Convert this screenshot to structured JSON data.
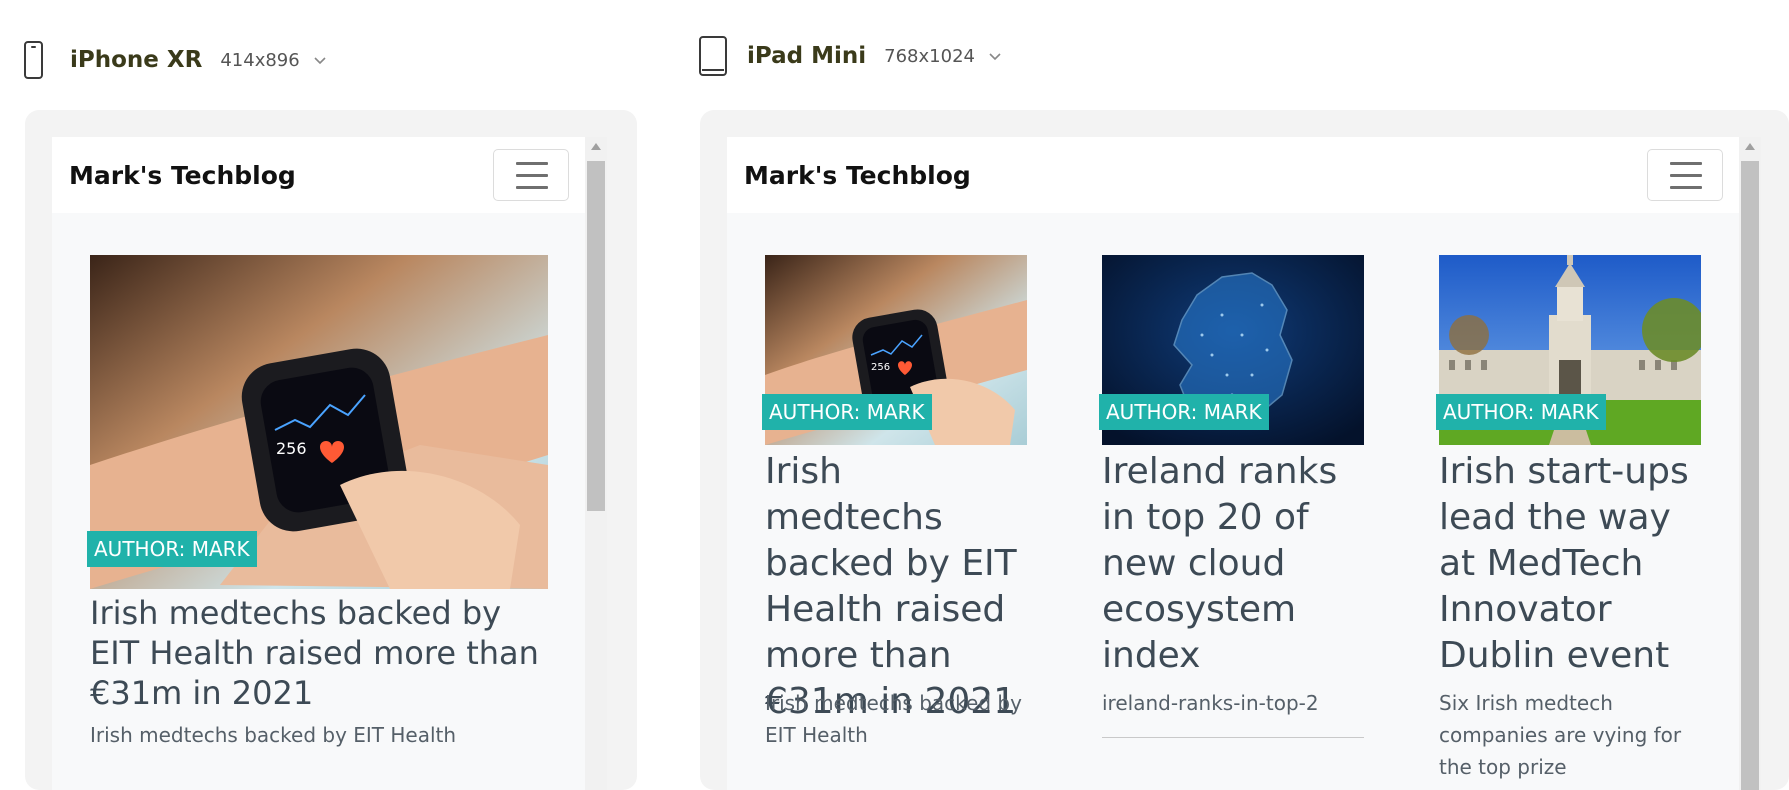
{
  "devices": [
    {
      "name": "iPhone XR",
      "size": "414x896",
      "icon": "phone-icon"
    },
    {
      "name": "iPad Mini",
      "size": "768x1024",
      "icon": "tablet-icon"
    }
  ],
  "site": {
    "brand": "Mark's Techblog"
  },
  "posts": [
    {
      "badge": "AUTHOR: MARK",
      "title": "Irish medtechs backed by EIT Health raised more than €31m in 2021",
      "excerpt": "Irish medtechs backed by EIT Health",
      "image": "smartwatch-photo"
    },
    {
      "badge": "AUTHOR: MARK",
      "title": "Ireland ranks in top 20 of new cloud ecosystem index",
      "excerpt": "ireland-ranks-in-top-2",
      "image": "ireland-map-photo"
    },
    {
      "badge": "AUTHOR: MARK",
      "title": "Irish start-ups lead the way at MedTech Innovator Dublin event",
      "excerpt": "Six Irish medtech companies are vying for the top prize",
      "image": "trinity-college-photo"
    }
  ],
  "colors": {
    "accent": "#20b2aa",
    "title": "#3d4a55"
  }
}
